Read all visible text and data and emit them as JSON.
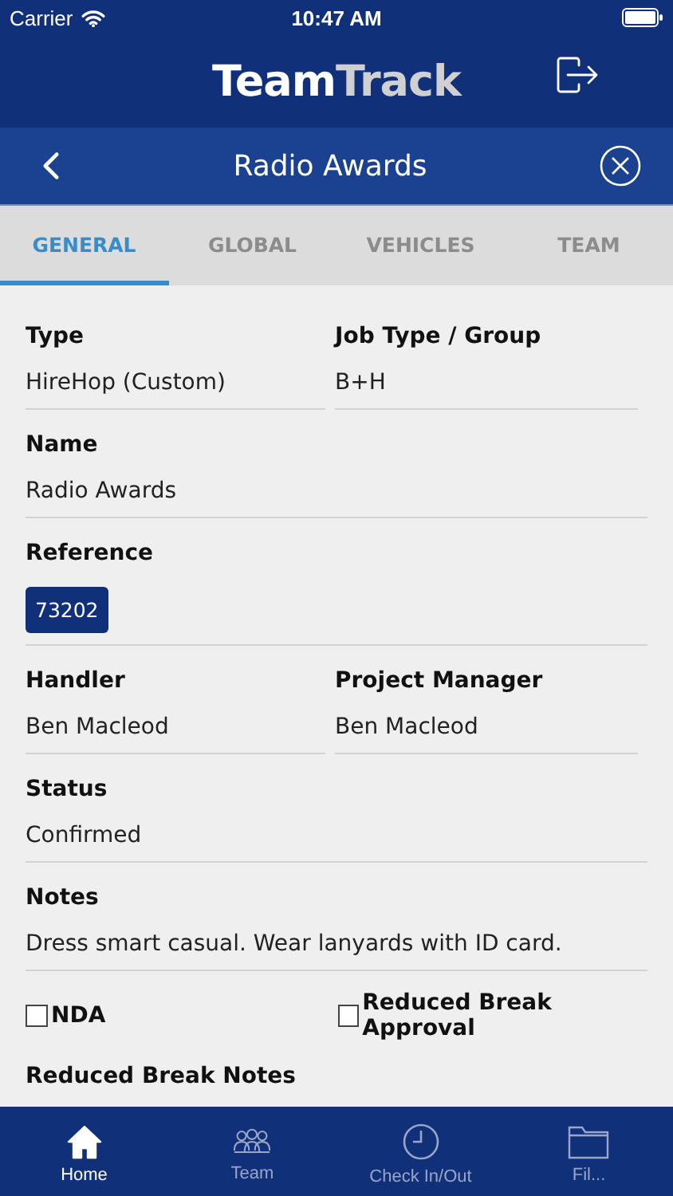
{
  "status_bar": {
    "carrier": "Carrier",
    "time": "10:47 AM"
  },
  "header": {
    "logo_primary": "Team",
    "logo_secondary": "Track"
  },
  "nav_bar": {
    "title": "Radio Awards"
  },
  "tabs": [
    {
      "label": "GENERAL",
      "selected": true
    },
    {
      "label": "GLOBAL",
      "selected": false
    },
    {
      "label": "VEHICLES",
      "selected": false
    },
    {
      "label": "TEAM",
      "selected": false
    }
  ],
  "field_rows": [
    {
      "cells": [
        {
          "label": "Type",
          "value": "HireHop (Custom)",
          "kind": "text"
        },
        {
          "label": "Job Type / Group",
          "value": "B+H",
          "kind": "text"
        }
      ]
    },
    {
      "cells": [
        {
          "label": "Name",
          "value": "Radio Awards",
          "kind": "text"
        }
      ]
    },
    {
      "cells": [
        {
          "label": "Reference",
          "value": "73202",
          "kind": "badge"
        }
      ]
    },
    {
      "cells": [
        {
          "label": "Handler",
          "value": "Ben Macleod",
          "kind": "text"
        },
        {
          "label": "Project Manager",
          "value": "Ben Macleod",
          "kind": "text"
        }
      ]
    },
    {
      "cells": [
        {
          "label": "Status",
          "value": "Confirmed",
          "kind": "text"
        }
      ]
    },
    {
      "cells": [
        {
          "label": "Notes",
          "value": "Dress smart casual. Wear lanyards with ID card.",
          "kind": "text"
        }
      ]
    }
  ],
  "checkboxes": [
    {
      "label": "NDA",
      "checked": false
    },
    {
      "label": "Reduced Break Approval",
      "checked": false
    }
  ],
  "reduced_break_notes": {
    "label": "Reduced Break Notes"
  },
  "tab_bar": [
    {
      "label": "Home",
      "kind": "home",
      "selected": true
    },
    {
      "label": "Team",
      "kind": "team",
      "selected": false
    },
    {
      "label": "Check In/Out",
      "kind": "clock",
      "selected": false
    },
    {
      "label": "Fil...",
      "kind": "folder",
      "selected": false
    }
  ]
}
